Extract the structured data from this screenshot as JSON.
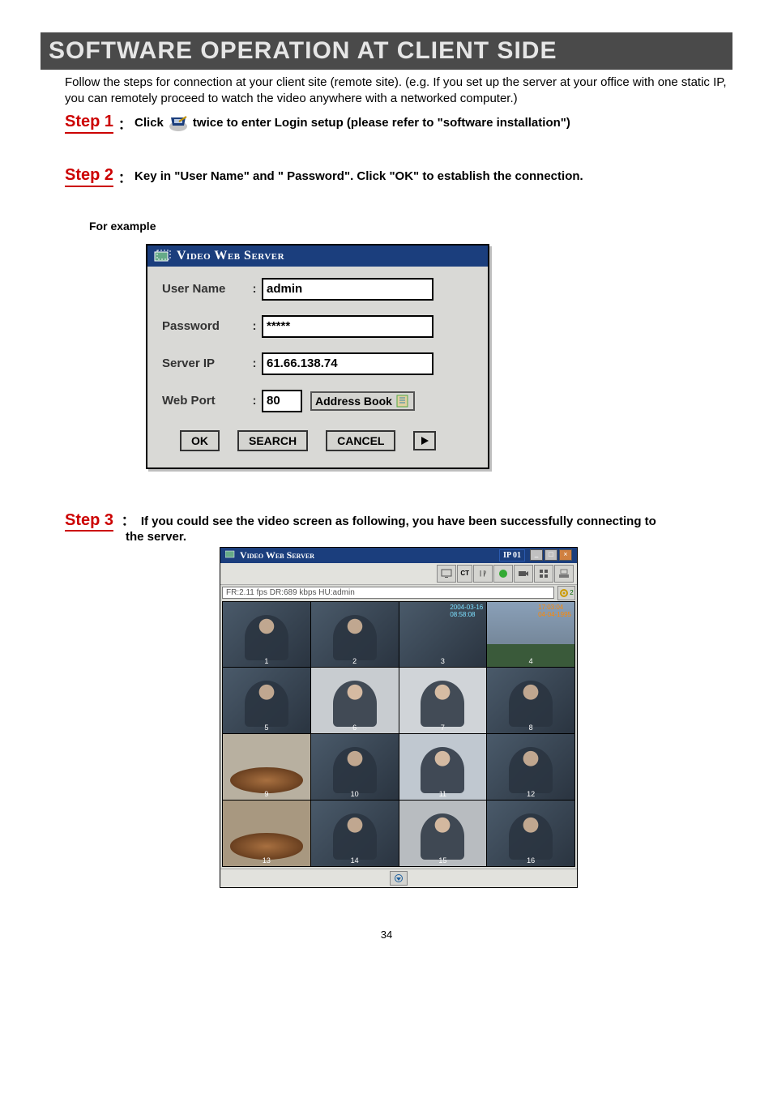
{
  "title": "SOFTWARE OPERATION AT CLIENT SIDE",
  "intro": "Follow  the steps for connection at your client site (remote site).  (e.g.  If you set up the server at your office with one static IP, you can remotely proceed to watch the video anywhere with a networked computer.)",
  "step1": {
    "label": "Step 1",
    "text_a": "Click",
    "text_b": "twice to enter Login setup (please refer to \"software installation\")"
  },
  "step2": {
    "label": "Step 2",
    "text": "Key in \"User Name\" and \" Password\". Click \"OK\" to establish the connection."
  },
  "example_label": "For example",
  "login": {
    "window_title": "Video Web Server",
    "username_label": "User Name",
    "username_value": "admin",
    "password_label": "Password",
    "password_value": "*****",
    "serverip_label": "Server IP",
    "serverip_value": "61.66.138.74",
    "webport_label": "Web Port",
    "webport_value": "80",
    "address_book": "Address Book",
    "ok": "OK",
    "search": "SEARCH",
    "cancel": "CANCEL"
  },
  "step3": {
    "label": "Step 3",
    "text": "If you could see the video screen as following, you have been successfully connecting to",
    "text2": "the server."
  },
  "viewer": {
    "title": "Video Web Server",
    "ip_badge": "IP 01",
    "status": "FR:2.11 fps DR:689 kbps    HU:admin",
    "toolbar_icons": [
      "monitor-icon",
      "ct-label",
      "meter-icon",
      "rec-icon",
      "cam-icon",
      "grid-icon",
      "sys-icon"
    ],
    "gear_count": "2"
  },
  "page_number": "34"
}
